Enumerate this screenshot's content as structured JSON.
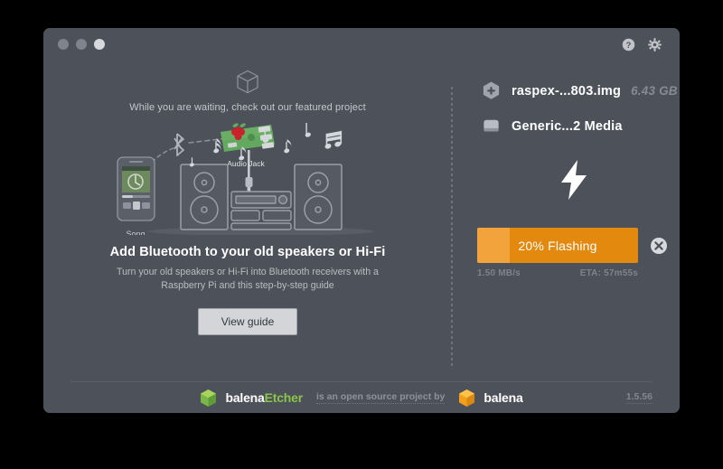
{
  "window": {
    "traffic_lights": [
      "close",
      "minimize",
      "zoom"
    ],
    "help_icon": "help-circle-icon",
    "settings_icon": "gear-icon"
  },
  "featured": {
    "cube_icon": "cube-outline-icon",
    "waiting_text": "While you are waiting, check out our featured project",
    "title": "Add Bluetooth to your old speakers or Hi-Fi",
    "description": "Turn your old speakers or Hi-Fi into Bluetooth receivers with a Raspberry Pi and this step-by-step guide",
    "button_label": "View guide",
    "illustration": {
      "song_label": "Song",
      "audio_jack_label": "Audio Jack",
      "bluetooth_icon": "bluetooth-icon",
      "board_icon": "raspberry-pi-board"
    }
  },
  "selection": {
    "image": {
      "icon": "image-file-icon",
      "name": "raspex-...803.img",
      "size": "6.43 GB"
    },
    "drive": {
      "icon": "drive-icon",
      "name": "Generic...2 Media"
    },
    "status_icon": "lightning-bolt-icon"
  },
  "progress": {
    "percent": 20,
    "label": "20% Flashing",
    "speed": "1.50 MB/s",
    "eta": "ETA: 57m55s",
    "cancel_icon": "cancel-circle-icon",
    "fill_color": "#f2a33c",
    "track_color": "#e3890e"
  },
  "footer": {
    "etcher_brand_1": "balena",
    "etcher_brand_2": "Etcher",
    "middle_text": "is an open source project by",
    "balena_brand": "balena",
    "version": "1.5.56",
    "accent_green": "#8bc44a",
    "accent_orange": "#f4a41c"
  }
}
